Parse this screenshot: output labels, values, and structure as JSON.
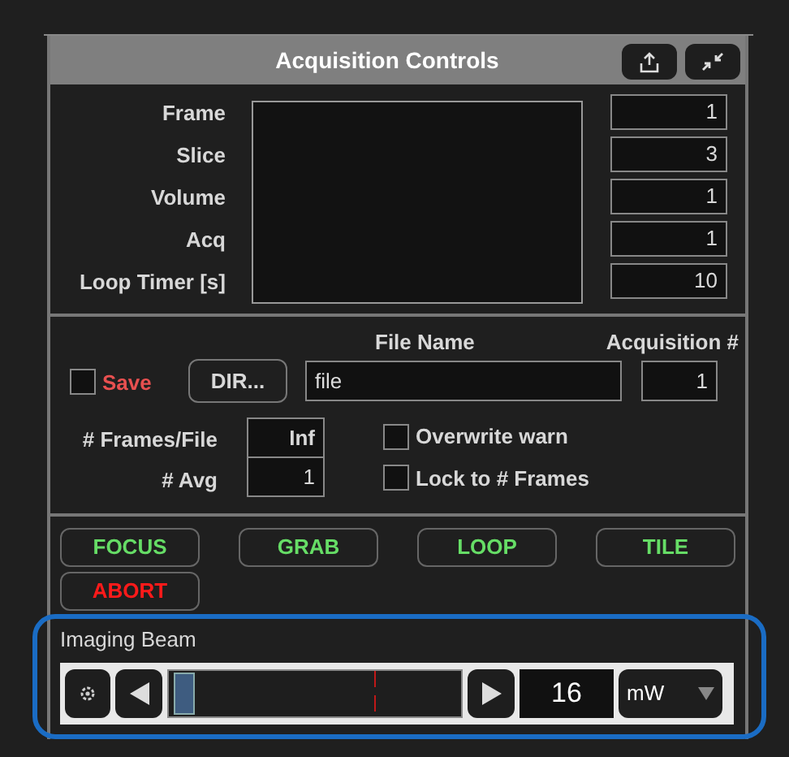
{
  "panel": {
    "title": "Acquisition Controls"
  },
  "counters": [
    {
      "label": "Frame",
      "value": "1"
    },
    {
      "label": "Slice",
      "value": "3"
    },
    {
      "label": "Volume",
      "value": "1"
    },
    {
      "label": "Acq",
      "value": "1"
    },
    {
      "label": "Loop Timer [s]",
      "value": "10"
    }
  ],
  "file": {
    "save_label": "Save",
    "save_checked": false,
    "dir_button": "DIR...",
    "file_name_header": "File Name",
    "file_name": "file",
    "acquisition_header": "Acquisition #",
    "acquisition": "1",
    "frames_per_file_label": "# Frames/File",
    "frames_per_file": "Inf",
    "avg_label": "# Avg",
    "avg": "1",
    "options": [
      {
        "label": "Overwrite warn",
        "checked": false
      },
      {
        "label": "Lock to # Frames",
        "checked": false
      }
    ]
  },
  "buttons": [
    {
      "label": "FOCUS",
      "color": "#66dd66"
    },
    {
      "label": "GRAB",
      "color": "#66dd66"
    },
    {
      "label": "LOOP",
      "color": "#66dd66"
    },
    {
      "label": "TILE",
      "color": "#66dd66"
    },
    {
      "label": "ABORT",
      "color": "#ff1a1a"
    }
  ],
  "beam": {
    "title": "Imaging Beam",
    "level": 0.02,
    "value": "16",
    "unit": "mW"
  }
}
